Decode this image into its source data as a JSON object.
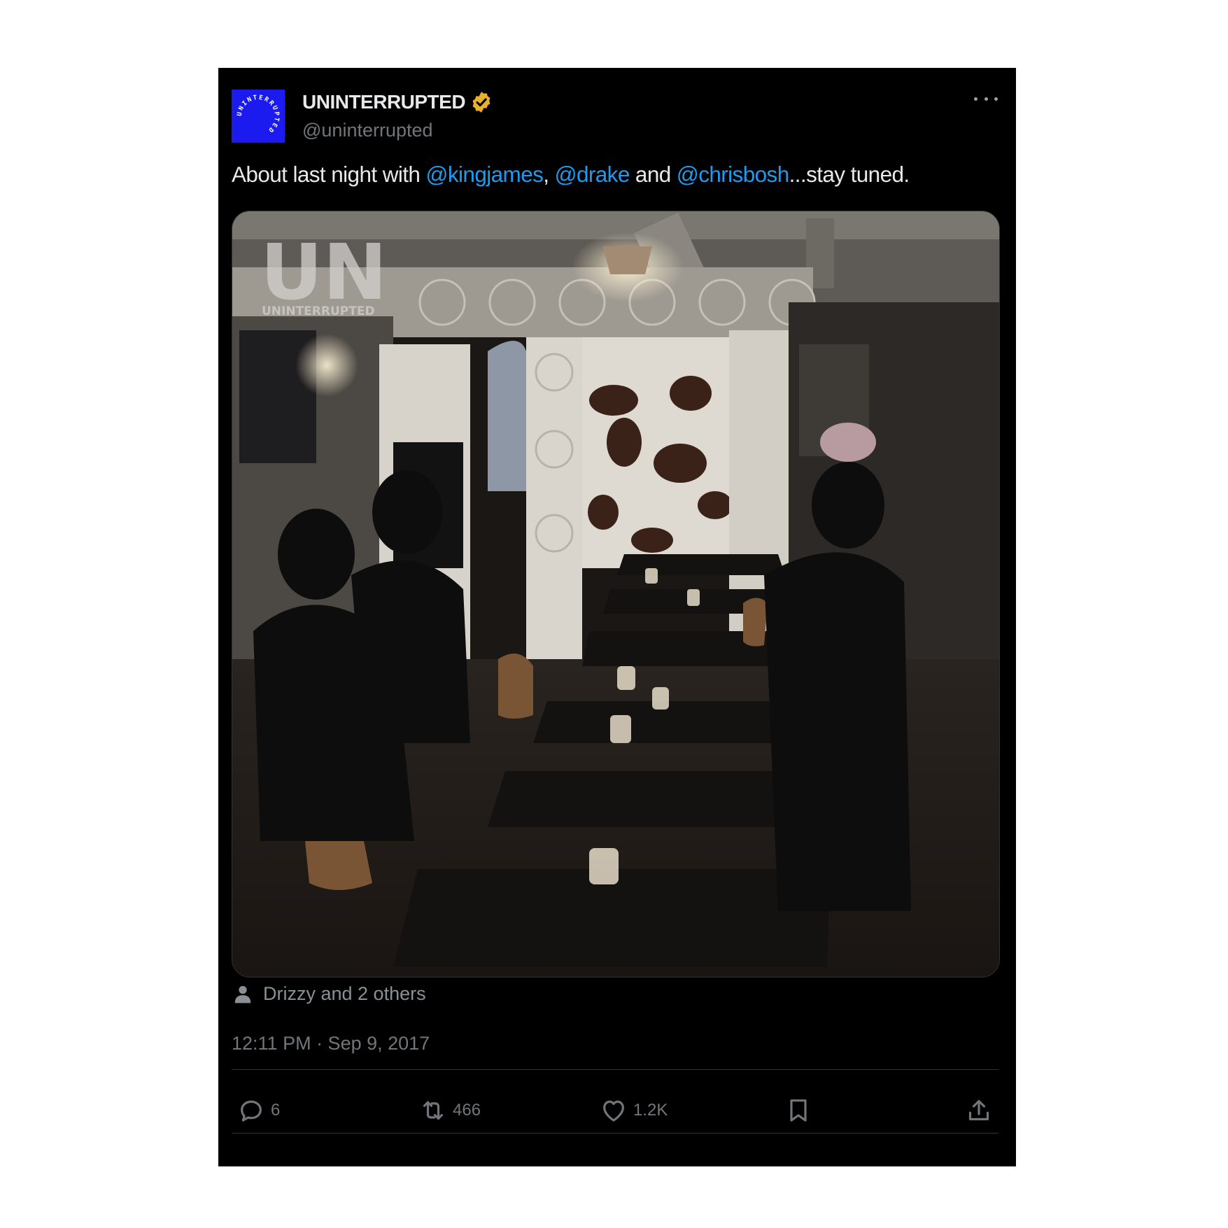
{
  "post": {
    "author": {
      "display_name": "UNINTERRUPTED",
      "handle": "@uninterrupted",
      "verified": true,
      "avatar_ring_text": "UNINTERRUPTED"
    },
    "text": {
      "part1": "About last night with ",
      "mention1": "@kingjames",
      "part2": ", ",
      "mention2": "@drake",
      "part3": " and ",
      "mention3": "@chrisbosh",
      "part4": "...stay tuned."
    },
    "media": {
      "watermark_logo": "UN",
      "watermark_text": "UNINTERRUPTED"
    },
    "tagged_people": "Drizzy and 2 others",
    "timestamp": "12:11 PM · Sep 9, 2017",
    "actions": {
      "replies": "6",
      "reposts": "466",
      "likes": "1.2K"
    }
  },
  "colors": {
    "background": "#000000",
    "text_primary": "#e7e9ea",
    "text_secondary": "#71767b",
    "link": "#1d9bf0",
    "verified_badge": "#e8b02c",
    "avatar_blue": "#1b1bf0"
  },
  "icons": [
    "verified-badge-icon",
    "more-icon",
    "person-icon",
    "reply-icon",
    "repost-icon",
    "like-icon",
    "bookmark-icon",
    "share-icon"
  ]
}
